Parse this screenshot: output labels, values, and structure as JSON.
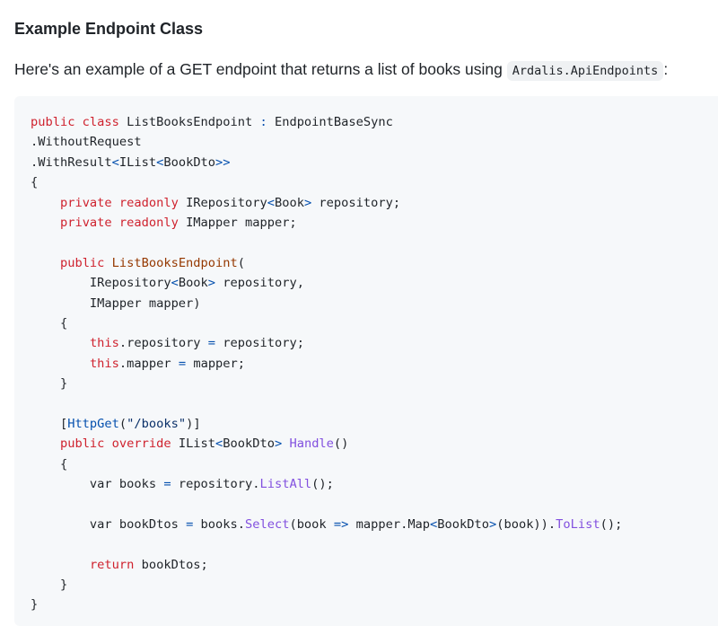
{
  "section": {
    "heading": "Example Endpoint Class",
    "intro_text": "Here's an example of a GET endpoint that returns a list of books using ",
    "intro_code": "Ardalis.ApiEndpoints",
    "intro_suffix": ":"
  },
  "code": {
    "language": "csharp",
    "lines": [
      [
        {
          "t": "kw",
          "v": "public class "
        },
        {
          "t": "pl",
          "v": "ListBooksEndpoint "
        },
        {
          "t": "op",
          "v": ":"
        },
        {
          "t": "pl",
          "v": " EndpointBaseSync"
        }
      ],
      [
        {
          "t": "pl",
          "v": ".WithoutRequest"
        }
      ],
      [
        {
          "t": "pl",
          "v": ".WithResult"
        },
        {
          "t": "op",
          "v": "<"
        },
        {
          "t": "pl",
          "v": "IList"
        },
        {
          "t": "op",
          "v": "<"
        },
        {
          "t": "pl",
          "v": "BookDto"
        },
        {
          "t": "op",
          "v": ">>"
        }
      ],
      [
        {
          "t": "pl",
          "v": "{"
        }
      ],
      [
        {
          "t": "pl",
          "v": "    "
        },
        {
          "t": "kw",
          "v": "private readonly "
        },
        {
          "t": "pl",
          "v": "IRepository"
        },
        {
          "t": "op",
          "v": "<"
        },
        {
          "t": "pl",
          "v": "Book"
        },
        {
          "t": "op",
          "v": ">"
        },
        {
          "t": "pl",
          "v": " repository;"
        }
      ],
      [
        {
          "t": "pl",
          "v": "    "
        },
        {
          "t": "kw",
          "v": "private readonly "
        },
        {
          "t": "pl",
          "v": "IMapper mapper;"
        }
      ],
      [
        {
          "t": "pl",
          "v": ""
        }
      ],
      [
        {
          "t": "pl",
          "v": "    "
        },
        {
          "t": "kw",
          "v": "public "
        },
        {
          "t": "br",
          "v": "ListBooksEndpoint"
        },
        {
          "t": "pl",
          "v": "("
        }
      ],
      [
        {
          "t": "pl",
          "v": "        IRepository"
        },
        {
          "t": "op",
          "v": "<"
        },
        {
          "t": "pl",
          "v": "Book"
        },
        {
          "t": "op",
          "v": ">"
        },
        {
          "t": "pl",
          "v": " repository,"
        }
      ],
      [
        {
          "t": "pl",
          "v": "        IMapper mapper)"
        }
      ],
      [
        {
          "t": "pl",
          "v": "    {"
        }
      ],
      [
        {
          "t": "pl",
          "v": "        "
        },
        {
          "t": "kw",
          "v": "this"
        },
        {
          "t": "pl",
          "v": ".repository "
        },
        {
          "t": "op",
          "v": "="
        },
        {
          "t": "pl",
          "v": " repository;"
        }
      ],
      [
        {
          "t": "pl",
          "v": "        "
        },
        {
          "t": "kw",
          "v": "this"
        },
        {
          "t": "pl",
          "v": ".mapper "
        },
        {
          "t": "op",
          "v": "="
        },
        {
          "t": "pl",
          "v": " mapper;"
        }
      ],
      [
        {
          "t": "pl",
          "v": "    }"
        }
      ],
      [
        {
          "t": "pl",
          "v": ""
        }
      ],
      [
        {
          "t": "pl",
          "v": "    ["
        },
        {
          "t": "ty",
          "v": "HttpGet"
        },
        {
          "t": "pl",
          "v": "("
        },
        {
          "t": "st",
          "v": "\"/books\""
        },
        {
          "t": "pl",
          "v": ")]"
        }
      ],
      [
        {
          "t": "pl",
          "v": "    "
        },
        {
          "t": "kw",
          "v": "public override "
        },
        {
          "t": "pl",
          "v": "IList"
        },
        {
          "t": "op",
          "v": "<"
        },
        {
          "t": "pl",
          "v": "BookDto"
        },
        {
          "t": "op",
          "v": ">"
        },
        {
          "t": "pl",
          "v": " "
        },
        {
          "t": "fn",
          "v": "Handle"
        },
        {
          "t": "pl",
          "v": "()"
        }
      ],
      [
        {
          "t": "pl",
          "v": "    {"
        }
      ],
      [
        {
          "t": "pl",
          "v": "        var books "
        },
        {
          "t": "op",
          "v": "="
        },
        {
          "t": "pl",
          "v": " repository."
        },
        {
          "t": "fn",
          "v": "ListAll"
        },
        {
          "t": "pl",
          "v": "();"
        }
      ],
      [
        {
          "t": "pl",
          "v": ""
        }
      ],
      [
        {
          "t": "pl",
          "v": "        var bookDtos "
        },
        {
          "t": "op",
          "v": "="
        },
        {
          "t": "pl",
          "v": " books."
        },
        {
          "t": "fn",
          "v": "Select"
        },
        {
          "t": "pl",
          "v": "(book "
        },
        {
          "t": "op",
          "v": "=>"
        },
        {
          "t": "pl",
          "v": " mapper.Map"
        },
        {
          "t": "op",
          "v": "<"
        },
        {
          "t": "pl",
          "v": "BookDto"
        },
        {
          "t": "op",
          "v": ">"
        },
        {
          "t": "pl",
          "v": "(book))."
        },
        {
          "t": "fn",
          "v": "ToList"
        },
        {
          "t": "pl",
          "v": "();"
        }
      ],
      [
        {
          "t": "pl",
          "v": ""
        }
      ],
      [
        {
          "t": "pl",
          "v": "        "
        },
        {
          "t": "kw",
          "v": "return "
        },
        {
          "t": "pl",
          "v": "bookDtos;"
        }
      ],
      [
        {
          "t": "pl",
          "v": "    }"
        }
      ],
      [
        {
          "t": "pl",
          "v": "}"
        }
      ]
    ]
  },
  "colors": {
    "keyword": "#cf222e",
    "type": "#0550ae",
    "function": "#8250df",
    "operator": "#0550ae",
    "constructor": "#953800",
    "string": "#0a3069",
    "code_background": "#f6f8fa"
  }
}
